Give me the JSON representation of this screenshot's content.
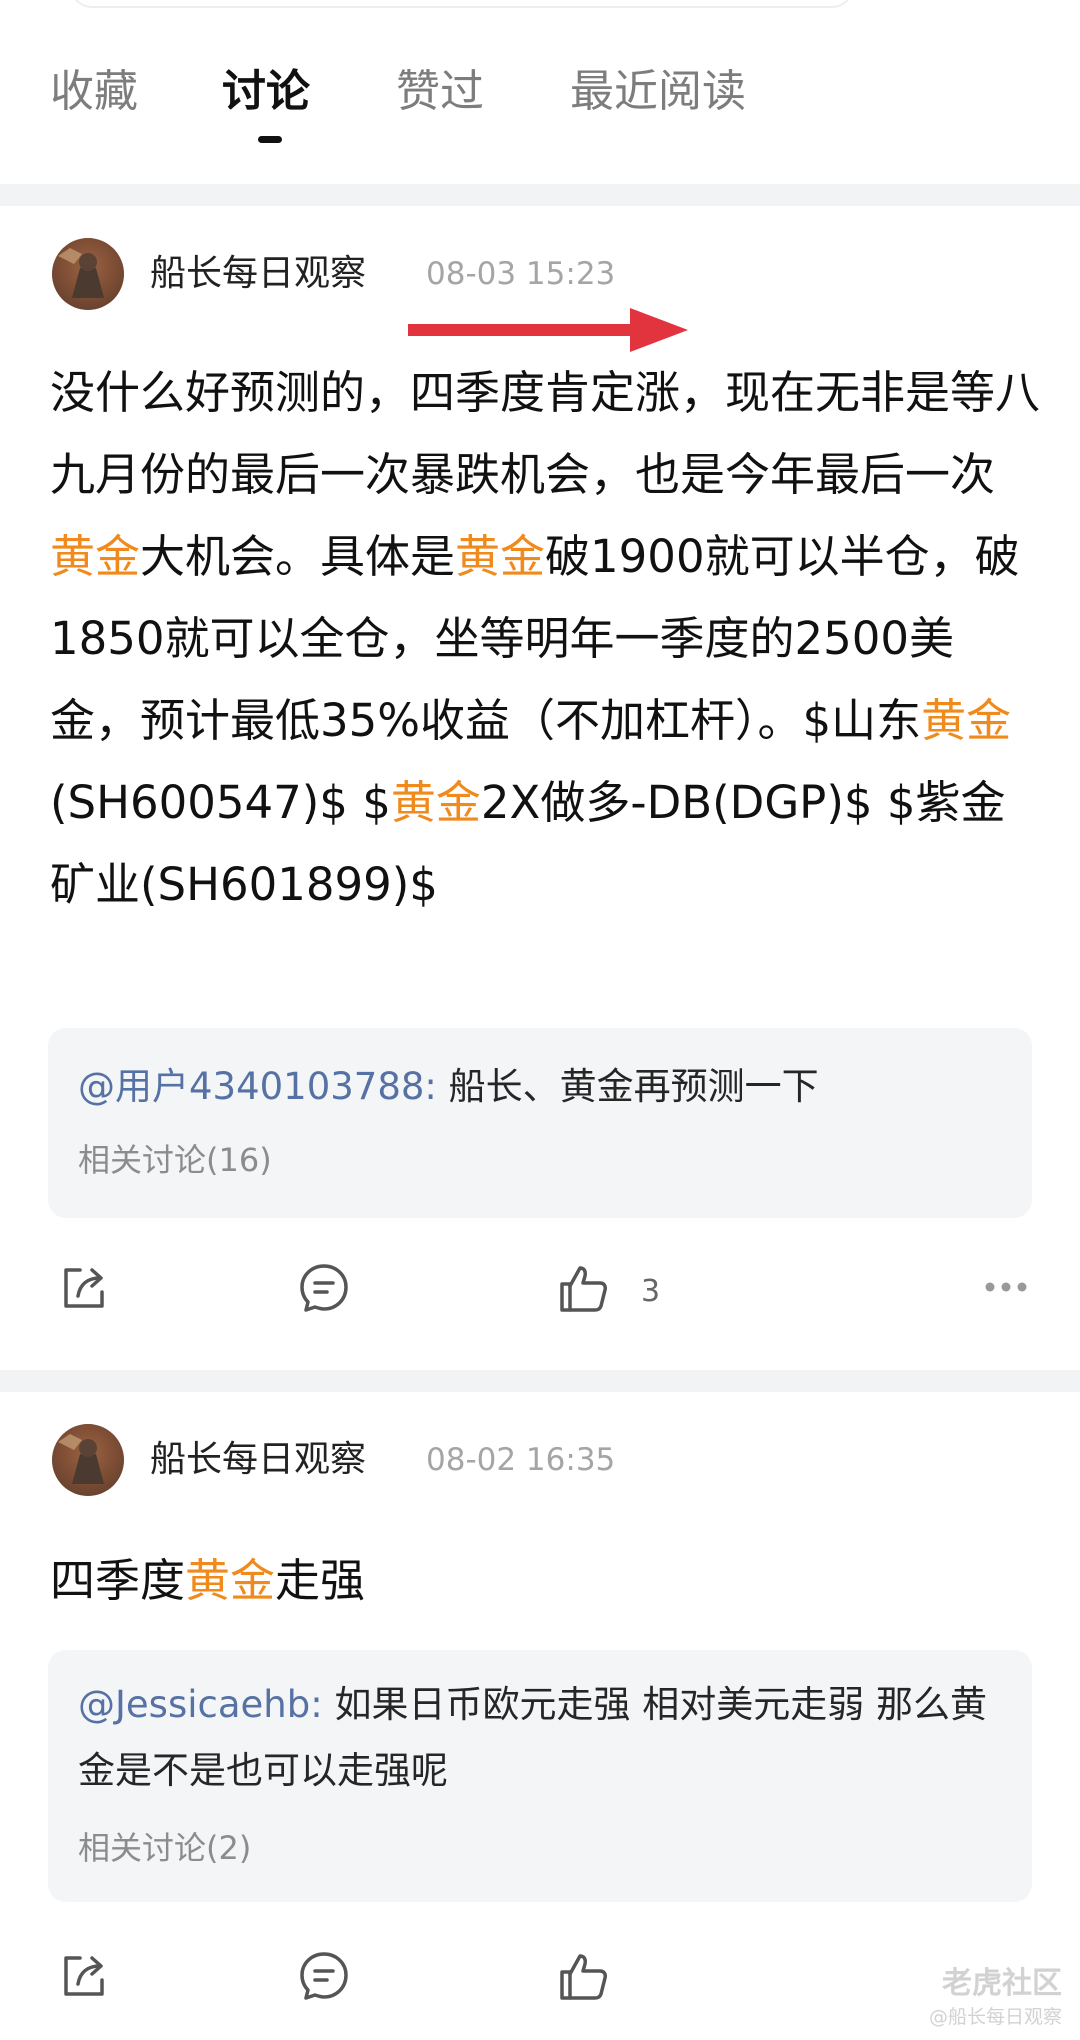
{
  "tabs": [
    {
      "label": "收藏"
    },
    {
      "label": "讨论"
    },
    {
      "label": "赞过"
    },
    {
      "label": "最近阅读"
    }
  ],
  "active_tab": "讨论",
  "highlight_color": "#f18a1c",
  "mention_color": "#5672a4",
  "posts": [
    {
      "author": "船长每日观察",
      "time": "08-03 15:23",
      "body": [
        {
          "t": "没什么好预测的，四季度肯定涨，现在无非是等八九月份的最后一次暴跌机会，也是今年最后一次"
        },
        {
          "t": "黄金",
          "hl": true
        },
        {
          "t": "大机会。具体是"
        },
        {
          "t": "黄金",
          "hl": true
        },
        {
          "t": "破1900就可以半仓，破1850就可以全仓，坐等明年一季度的2500美金，预计最低35%收益（不加杠杆）。$山东"
        },
        {
          "t": "黄金",
          "hl": true
        },
        {
          "t": "(SH600547)$ $"
        },
        {
          "t": "黄金",
          "hl": true
        },
        {
          "t": "2X做多-DB(DGP)$ $紫金矿业(SH601899)$"
        }
      ],
      "quote": {
        "mention": "@用户4340103788:",
        "text": " 船长、黄金再预测一下",
        "related": "相关讨论(16)"
      },
      "actions": {
        "share_icon": "share-icon",
        "comment_icon": "comment-icon",
        "like_icon": "thumbs-up-icon",
        "like_count": "3",
        "more_icon": "more-icon"
      }
    },
    {
      "author": "船长每日观察",
      "time": "08-02 16:35",
      "body": [
        {
          "t": "四季度"
        },
        {
          "t": "黄金",
          "hl": true
        },
        {
          "t": "走强"
        }
      ],
      "quote": {
        "mention": "@Jessicaehb:",
        "text": " 如果日币欧元走强 相对美元走弱 那么黄金是不是也可以走强呢",
        "related": "相关讨论(2)"
      },
      "actions": {
        "share_icon": "share-icon",
        "comment_icon": "comment-icon",
        "like_icon": "thumbs-up-icon"
      }
    }
  ],
  "watermark": {
    "brand": "老虎社区",
    "user": "@船长每日观察"
  }
}
